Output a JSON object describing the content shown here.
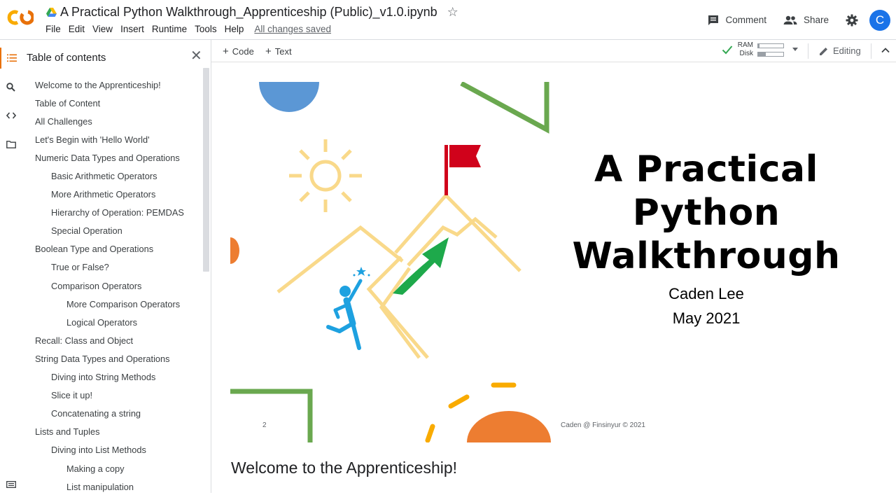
{
  "header": {
    "doc_title": "A Practical Python Walkthrough_Apprenticeship (Public)_v1.0.ipynb",
    "menu": [
      "File",
      "Edit",
      "View",
      "Insert",
      "Runtime",
      "Tools",
      "Help"
    ],
    "save_status": "All changes saved",
    "comment_label": "Comment",
    "share_label": "Share",
    "avatar_initial": "C"
  },
  "sidebar": {
    "title": "Table of contents",
    "items": [
      {
        "label": "Welcome to the Apprenticeship!",
        "level": 0
      },
      {
        "label": "Table of Content",
        "level": 0
      },
      {
        "label": "All Challenges",
        "level": 0
      },
      {
        "label": "Let's Begin with 'Hello World'",
        "level": 0
      },
      {
        "label": "Numeric Data Types and Operations",
        "level": 0
      },
      {
        "label": "Basic Arithmetic Operators",
        "level": 1
      },
      {
        "label": "More Arithmetic Operators",
        "level": 1
      },
      {
        "label": "Hierarchy of Operation: PEMDAS",
        "level": 1
      },
      {
        "label": "Special Operation",
        "level": 1
      },
      {
        "label": "Boolean Type and Operations",
        "level": 0
      },
      {
        "label": "True or False?",
        "level": 1
      },
      {
        "label": "Comparison Operators",
        "level": 1
      },
      {
        "label": "More Comparison Operators",
        "level": 2
      },
      {
        "label": "Logical Operators",
        "level": 2
      },
      {
        "label": "Recall: Class and Object",
        "level": 0
      },
      {
        "label": "String Data Types and Operations",
        "level": 0
      },
      {
        "label": "Diving into String Methods",
        "level": 1
      },
      {
        "label": "Slice it up!",
        "level": 1
      },
      {
        "label": "Concatenating a string",
        "level": 1
      },
      {
        "label": "Lists and Tuples",
        "level": 0
      },
      {
        "label": "Diving into List Methods",
        "level": 1
      },
      {
        "label": "Making a copy",
        "level": 2
      },
      {
        "label": "List manipulation",
        "level": 2
      }
    ]
  },
  "toolbar": {
    "add_code": "Code",
    "add_text": "Text",
    "ram_label": "RAM",
    "disk_label": "Disk",
    "ram_usage": 0.05,
    "disk_usage": 0.3,
    "mode_label": "Editing"
  },
  "slide": {
    "title": "A Practical Python Walkthrough",
    "author": "Caden Lee",
    "date": "May 2021",
    "page_number": "2",
    "footer": "Caden @ Finsinyur © 2021"
  },
  "content": {
    "section_heading": "Welcome to the Apprenticeship!"
  },
  "colors": {
    "brand_orange": "#e8710a",
    "brand_yellow": "#f9ab00",
    "accent_blue": "#1a73e8",
    "slide_blue": "#5b97d5",
    "slide_green": "#6aa84f",
    "slide_orange": "#ed7d31",
    "slide_gold": "#f9d98a",
    "flag_red": "#d0021b",
    "arrow_green": "#1ea94b",
    "figure_blue": "#1ea1e0"
  }
}
